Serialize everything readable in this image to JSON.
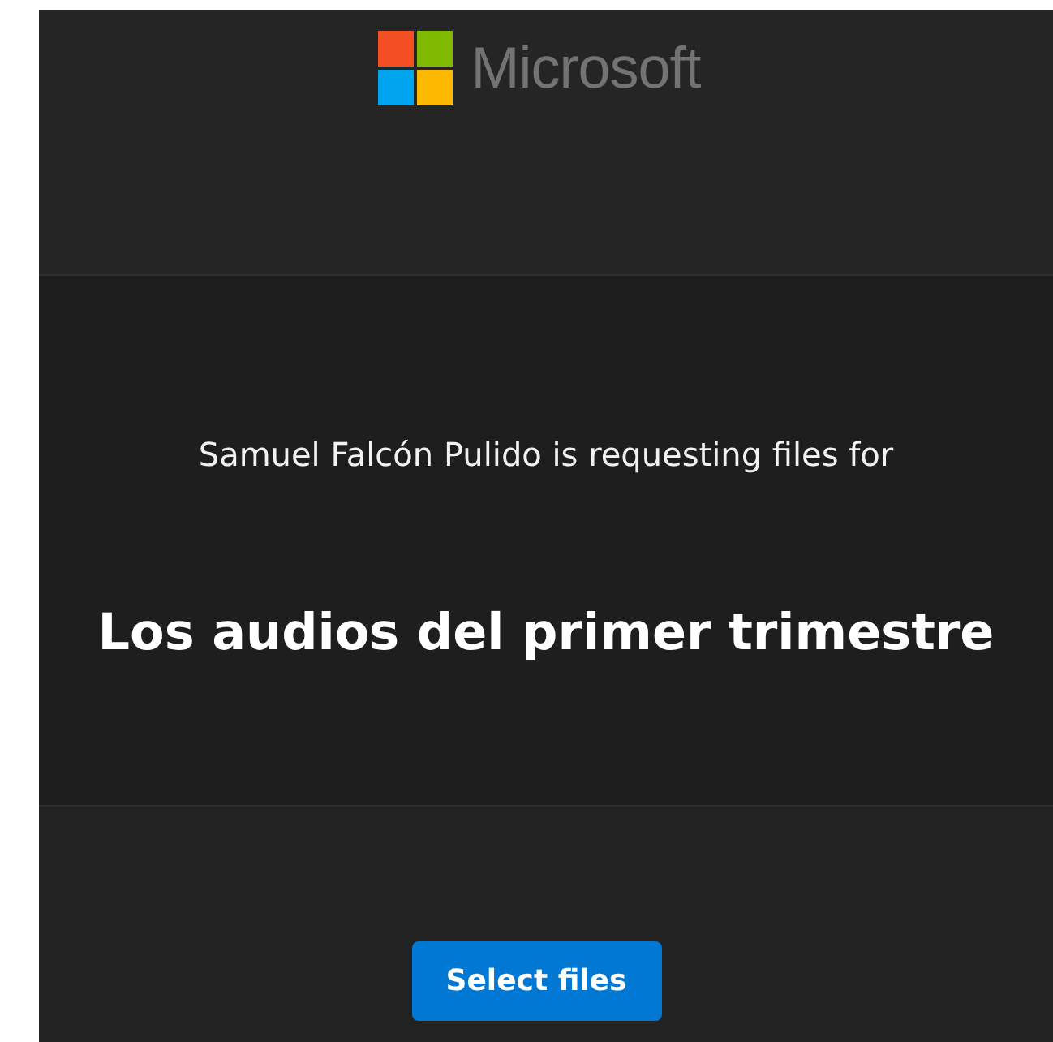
{
  "header": {
    "brand": "Microsoft"
  },
  "request": {
    "requester_line": "Samuel Falcón Pulido is requesting files for",
    "title": "Los audios del primer trimestre"
  },
  "actions": {
    "button": "Select files"
  }
}
